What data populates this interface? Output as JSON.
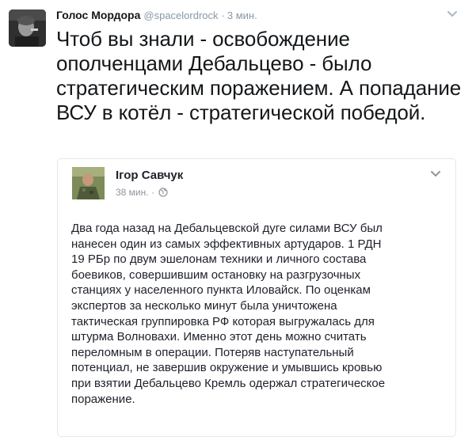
{
  "tweet": {
    "author_name": "Голос Мордора",
    "author_handle": "@spacelordrock",
    "separator": "·",
    "time": "3 мин.",
    "text": "Чтоб вы знали - освобождение ополченцами Дебальцево - было стратегическим поражением. А попадание ВСУ в котёл - стратегической победой."
  },
  "quoted_post": {
    "author_name": "Ігор Савчук",
    "time": "38 мин.",
    "separator": "·",
    "privacy_icon": "globe-icon",
    "body": "Два года назад на Дебальцевской дуге силами ВСУ был\nнанесен один из самых эффективных артударов.  1 РДН\n19 РБр по двум эшелонам техники и личного состава\nбоевиков, совершившим остановку на разгрузочных\nстанциях у населенного пункта Иловайск. По оценкам\nэкспертов за несколько минут была уничтожена\nтактическая группировка РФ которая выгружалась для\nштурма Волновахи. Именно этот день можно считать\nпереломным в операции. Потеряв наступательный\nпотенциал, не завершив окружение  и умывшись кровью\nпри взятии Дебальцево Кремль одержал стратегическое\nпоражение."
  },
  "icons": {
    "caret": "chevron-down-icon"
  },
  "colors": {
    "secondary_text": "#8899a6",
    "border": "#e1e8ed"
  }
}
